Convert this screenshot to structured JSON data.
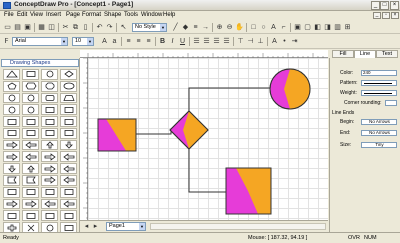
{
  "window": {
    "title": "ConceptDraw Pro - [Concept1 - Page1]"
  },
  "menu": [
    "File",
    "Edit",
    "View",
    "Insert",
    "Page",
    "Format",
    "Shape",
    "Tools",
    "Window",
    "Help"
  ],
  "toolbar": {
    "style_value": "No Style",
    "font_value": "Arial",
    "size_value": "10"
  },
  "panel": {
    "title": "Drawing Shapes"
  },
  "canvas": {
    "colors": {
      "fill_magenta": "#e63cd8",
      "fill_orange": "#f5a623",
      "connector": "#333333"
    }
  },
  "properties": {
    "tabs": [
      "Fill",
      "Line",
      "Text"
    ],
    "active_tab": "Line",
    "color_label": "Color:",
    "color_value": "240",
    "pattern_label": "Pattern:",
    "weight_label": "Weight:",
    "corner_label": "Corner rounding:",
    "ends_label": "Line Ends",
    "begin_label": "Begin:",
    "begin_value": "No Arrows",
    "end_label": "End:",
    "end_value": "No Arrows",
    "size_label": "Size:",
    "size_value": "Tiny"
  },
  "pagebar": {
    "page_name": "Page1"
  },
  "status": {
    "left": "Ready",
    "mouse": "Mouse: [ 187.32, 94.19 ]",
    "ovr": "OVR",
    "num": "NUM"
  }
}
